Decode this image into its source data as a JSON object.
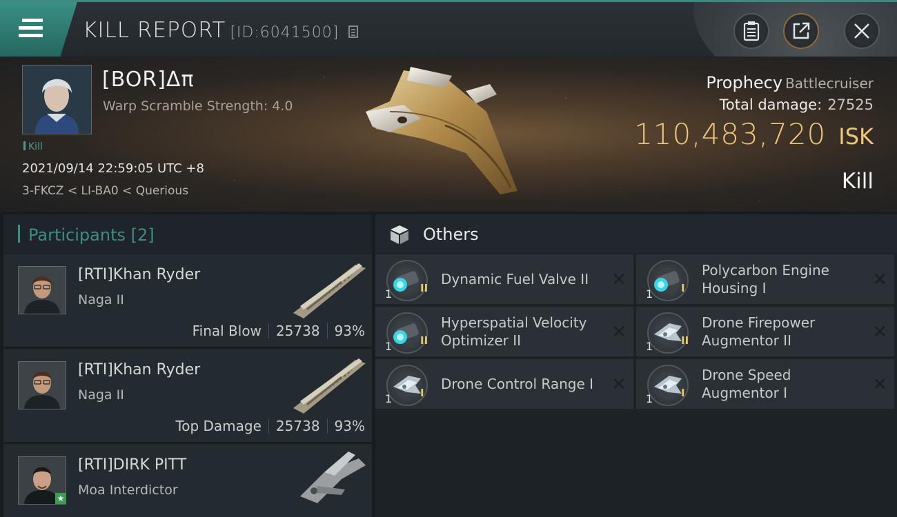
{
  "header": {
    "title": "KILL REPORT",
    "id": "[ID:6041500]",
    "icons": [
      "menu-icon",
      "copy-icon",
      "clipboard-icon",
      "share-icon",
      "close-icon"
    ]
  },
  "victim": {
    "name": "[BOR]Δπ",
    "scramble": "Warp Scramble Strength: 4.0",
    "kill_tag": "Kill",
    "datetime": "2021/09/14 22:59:05 UTC +8",
    "location": "3-FKCZ < LI-BA0 < Querious",
    "ship_name": "Prophecy",
    "ship_class": "Battlecruiser",
    "total_damage_label": "Total damage:",
    "total_damage": "27525",
    "isk_amount": "110,483,720",
    "isk_unit": "ISK",
    "result": "Kill"
  },
  "participants": {
    "label": "Participants",
    "count": "[2]",
    "rows": [
      {
        "name": "[RTI]Khan Ryder",
        "ship": "Naga II",
        "stat_label": "Final Blow",
        "damage": "25738",
        "percent": "93%"
      },
      {
        "name": "[RTI]Khan Ryder",
        "ship": "Naga II",
        "stat_label": "Top Damage",
        "damage": "25738",
        "percent": "93%"
      },
      {
        "name": "[RTI]DIRK PITT",
        "ship": "Moa Interdictor",
        "badge": "★"
      }
    ]
  },
  "others": {
    "label": "Others",
    "items": [
      {
        "name": "Dynamic Fuel Valve II",
        "qty": "1",
        "meta": "II",
        "icon": "thruster-module-icon"
      },
      {
        "name": "Polycarbon Engine Housing I",
        "qty": "1",
        "meta": "I",
        "icon": "thruster-module-icon"
      },
      {
        "name": "Hyperspatial Velocity Optimizer II",
        "qty": "1",
        "meta": "II",
        "icon": "thruster-module-icon"
      },
      {
        "name": "Drone Firepower Augmentor II",
        "qty": "1",
        "meta": "II",
        "icon": "drone-rig-icon"
      },
      {
        "name": "Drone Control Range I",
        "qty": "1",
        "meta": "I",
        "icon": "drone-rig-icon"
      },
      {
        "name": "Drone Speed Augmentor I",
        "qty": "1",
        "meta": "I",
        "icon": "drone-rig-icon"
      }
    ],
    "remove_glyph": "✕"
  },
  "colors": {
    "accent": "#3e8d85",
    "isk_gold": "#f0c77a",
    "meta_gold": "#e8c866"
  }
}
